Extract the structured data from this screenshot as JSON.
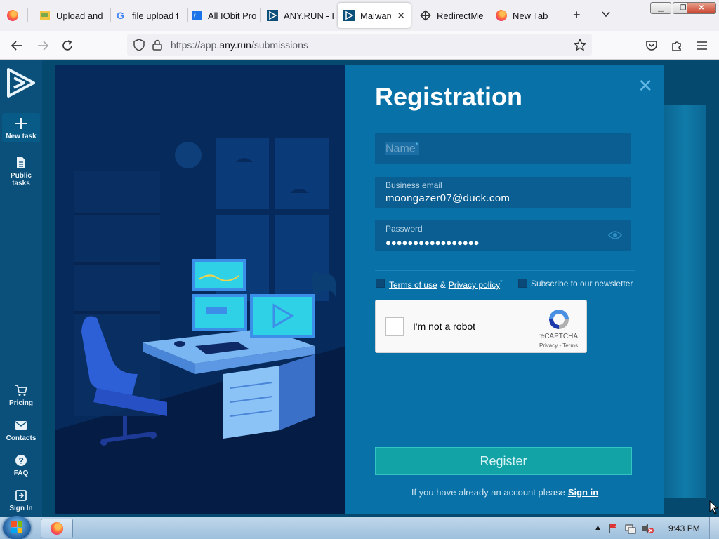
{
  "browser": {
    "tabs": [
      {
        "label": "Upload and",
        "icon": "upload-page-icon"
      },
      {
        "label": "file upload f",
        "icon": "google-icon"
      },
      {
        "label": "All IObit Pro",
        "icon": "iobit-icon"
      },
      {
        "label": "ANY.RUN - I",
        "icon": "anyrun-icon"
      },
      {
        "label": "Malware",
        "icon": "anyrun-icon",
        "active": true
      },
      {
        "label": "RedirectMe",
        "icon": "redirect-icon"
      },
      {
        "label": "New Tab",
        "icon": "firefox-icon"
      }
    ],
    "url_prefix": "https://app.",
    "url_domain": "any.run",
    "url_path": "/submissions"
  },
  "sidebar": {
    "items": [
      {
        "label": "New task",
        "icon": "plus-icon"
      },
      {
        "label": "Public tasks",
        "icon": "document-icon"
      },
      {
        "label": "Pricing",
        "icon": "cart-icon"
      },
      {
        "label": "Contacts",
        "icon": "mail-icon"
      },
      {
        "label": "FAQ",
        "icon": "help-icon"
      },
      {
        "label": "Sign In",
        "icon": "signin-icon"
      }
    ]
  },
  "registration": {
    "title": "Registration",
    "name_placeholder": "Name",
    "required_mark": "*",
    "email_label": "Business email",
    "email_value": "moongazer07@duck.com",
    "password_label": "Password",
    "password_value": "●●●●●●●●●●●●●●●●●",
    "terms_label": "Terms of use",
    "amp": "&",
    "privacy_label": "Privacy policy",
    "newsletter_label": "Subscribe to our newsletter",
    "register_label": "Register",
    "signin_prompt": "If you have already an account please",
    "signin_link": "Sign in"
  },
  "captcha": {
    "label": "I'm not a robot",
    "brand": "reCAPTCHA",
    "links": "Privacy - Terms"
  },
  "taskbar": {
    "time": "9:43 PM"
  }
}
